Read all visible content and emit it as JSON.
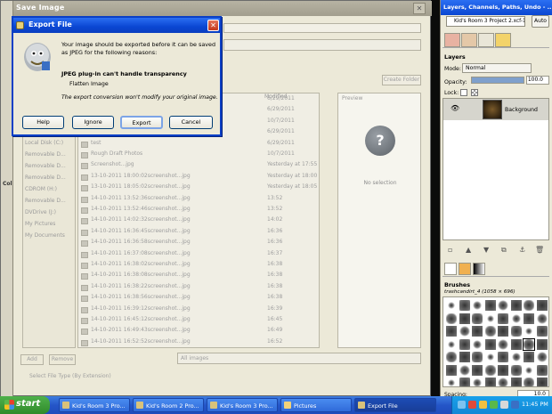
{
  "save_window": {
    "title": "Save Image",
    "create_folder": "Create Folder",
    "modified_header": "Modified",
    "preview_header": "Preview",
    "no_selection": "No selection",
    "places": [
      "Local Disk (C:)",
      "Removable D...",
      "Removable D...",
      "Removable D...",
      "CDROM (H:)",
      "Removable D...",
      "DVDrive (J:)",
      "My Pictures",
      "My Documents"
    ],
    "files": [
      {
        "name": "",
        "date": "6/29/2011"
      },
      {
        "name": "",
        "date": "6/29/2011"
      },
      {
        "name": "",
        "date": "10/7/2011"
      },
      {
        "name": "",
        "date": "6/29/2011"
      },
      {
        "name": "test",
        "date": "6/29/2011"
      },
      {
        "name": "Rough Draft Photos",
        "date": "10/7/2011"
      },
      {
        "name": "Screenshot...jpg",
        "date": "Yesterday at 17:55"
      },
      {
        "name": "13-10-2011 18:00:02screenshot...jpg",
        "date": "Yesterday at 18:00"
      },
      {
        "name": "13-10-2011 18:05:02screenshot...jpg",
        "date": "Yesterday at 18:05"
      },
      {
        "name": "14-10-2011 13:52:36screenshot...jpg",
        "date": "13:52"
      },
      {
        "name": "14-10-2011 13:52:46screenshot...jpg",
        "date": "13:52"
      },
      {
        "name": "14-10-2011 14:02:32screenshot...jpg",
        "date": "14:02"
      },
      {
        "name": "14-10-2011 16:36:45screenshot...jpg",
        "date": "16:36"
      },
      {
        "name": "14-10-2011 16:36:58screenshot...jpg",
        "date": "16:36"
      },
      {
        "name": "14-10-2011 16:37:08screenshot...jpg",
        "date": "16:37"
      },
      {
        "name": "14-10-2011 16:38:02screenshot...jpg",
        "date": "16:38"
      },
      {
        "name": "14-10-2011 16:38:08screenshot...jpg",
        "date": "16:38"
      },
      {
        "name": "14-10-2011 16:38:22screenshot...jpg",
        "date": "16:38"
      },
      {
        "name": "14-10-2011 16:38:56screenshot...jpg",
        "date": "16:38"
      },
      {
        "name": "14-10-2011 16:39:12screenshot...jpg",
        "date": "16:39"
      },
      {
        "name": "14-10-2011 16:45:12screenshot...jpg",
        "date": "16:45"
      },
      {
        "name": "14-10-2011 16:49:43screenshot...jpg",
        "date": "16:49"
      },
      {
        "name": "14-10-2011 16:52:52screenshot...jpg",
        "date": "16:52"
      }
    ],
    "add": "Add",
    "remove": "Remove",
    "filter": "All images",
    "select_file_type": "Select File Type (By Extension)",
    "help": "Help",
    "left_label": "Col"
  },
  "export_dialog": {
    "title": "Export File",
    "message": "Your image should be exported before it can be saved as JPEG for the following reasons:",
    "reason_title": "JPEG plug-in can't handle transparency",
    "reason": "Flatten Image",
    "note": "The export conversion won't modify your original image.",
    "buttons": {
      "help": "Help",
      "ignore": "Ignore",
      "export": "Export",
      "cancel": "Cancel"
    }
  },
  "dock": {
    "title": "Layers, Channels, Paths, Undo - ...",
    "image": "Kid's Room 3 Project 2.xcf-1",
    "auto": "Auto",
    "layers_header": "Layers",
    "mode_label": "Mode:",
    "mode_value": "Normal",
    "opacity_label": "Opacity:",
    "opacity_value": "100.0",
    "lock_label": "Lock:",
    "layer_name": "Background",
    "brushes_header": "Brushes",
    "brush_name": "trashcandirt_4 (1058 × 696)",
    "spacing_label": "Spacing:",
    "spacing_value": "10.0"
  },
  "taskbar": {
    "start": "start",
    "tasks": [
      "Kid's Room 3 Pro...",
      "Kid's Room 2 Pro...",
      "Kid's Room 3 Pro...",
      "Pictures",
      "Export File"
    ],
    "clock": "11:45 PM"
  }
}
